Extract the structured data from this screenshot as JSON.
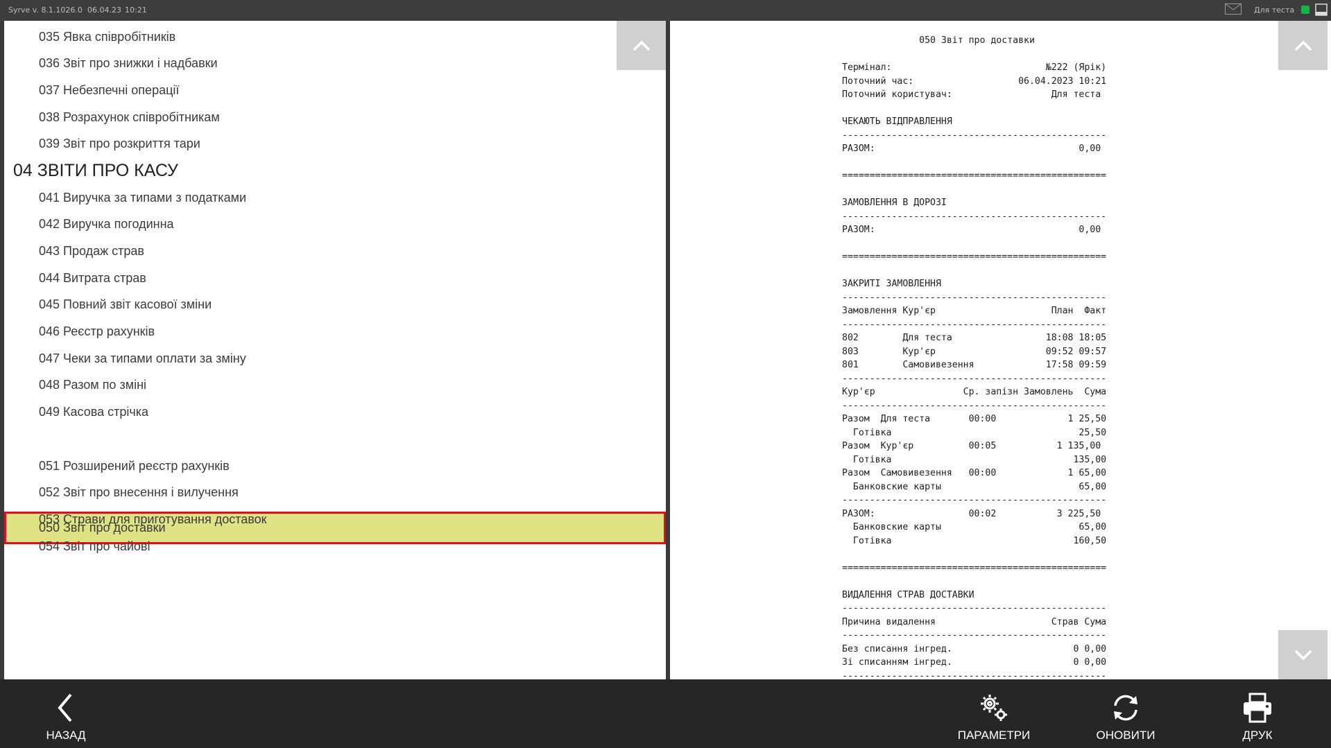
{
  "topbar": {
    "version": "Syrve v. 8.1.1026.0",
    "date": "06.04.23",
    "time": "10:21",
    "user": "Для теста",
    "status_color": "#17b34a"
  },
  "report_list": {
    "items": [
      {
        "label": "035 Явка співробітників",
        "type": "report"
      },
      {
        "label": "036 Звіт про знижки і надбавки",
        "type": "report"
      },
      {
        "label": "037 Небезпечні операції",
        "type": "report"
      },
      {
        "label": "038 Розрахунок співробітникам",
        "type": "report"
      },
      {
        "label": "039 Звіт про розкриття тари",
        "type": "report"
      },
      {
        "label": "04 ЗВІТИ ПРО КАСУ",
        "type": "section"
      },
      {
        "label": "041 Виручка за типами з податками",
        "type": "report"
      },
      {
        "label": "042 Виручка погодинна",
        "type": "report"
      },
      {
        "label": "043 Продаж страв",
        "type": "report"
      },
      {
        "label": "044 Витрата страв",
        "type": "report"
      },
      {
        "label": "045 Повний звіт касової зміни",
        "type": "report"
      },
      {
        "label": "046 Реєстр рахунків",
        "type": "report"
      },
      {
        "label": "047 Чеки за типами оплати за зміну",
        "type": "report"
      },
      {
        "label": "048 Разом по зміні",
        "type": "report"
      },
      {
        "label": "049 Касова стрічка",
        "type": "report"
      },
      {
        "label": "050 Звіт про доставки",
        "type": "report",
        "selected": true
      },
      {
        "label": "051 Розширений реєстр рахунків",
        "type": "report"
      },
      {
        "label": "052 Звіт про внесення і вилучення",
        "type": "report"
      },
      {
        "label": "053 Страви для приготування доставок",
        "type": "report"
      },
      {
        "label": "054 Звіт про чайові",
        "type": "report"
      }
    ],
    "selected_color": "#dfe384",
    "selected_border_color": "#e00f1e"
  },
  "report_preview": {
    "lines": [
      "              050 Звіт про доставки",
      "",
      "Термінал:                            №222 (Ярік)",
      "Поточний час:                   06.04.2023 10:21",
      "Поточний користувач:                  Для теста",
      "",
      "ЧЕКАЮТЬ ВІДПРАВЛЕННЯ",
      "------------------------------------------------",
      "РАЗОМ:                                     0,00",
      "",
      "================================================",
      "",
      "ЗАМОВЛЕННЯ В ДОРОЗІ",
      "------------------------------------------------",
      "РАЗОМ:                                     0,00",
      "",
      "================================================",
      "",
      "ЗАКРИТІ ЗАМОВЛЕННЯ",
      "------------------------------------------------",
      "Замовлення Кур'єр                     План  Факт",
      "------------------------------------------------",
      "802        Для теста                 18:08 18:05",
      "803        Кур'єр                    09:52 09:57",
      "801        Самовивезення             17:58 09:59",
      "------------------------------------------------",
      "Кур'єр                Ср. запізн Замовлень  Сума",
      "------------------------------------------------",
      "Разом  Для теста       00:00             1 25,50",
      "  Готівка                                  25,50",
      "Разом  Кур'єр          00:05           1 135,00",
      "  Готівка                                 135,00",
      "Разом  Самовивезення   00:00             1 65,00",
      "  Банковские карты                         65,00",
      "------------------------------------------------",
      "РАЗОМ:                 00:02           3 225,50",
      "  Банковские карты                         65,00",
      "  Готівка                                 160,50",
      "",
      "================================================",
      "",
      "ВИДАЛЕННЯ СТРАВ ДОСТАВКИ",
      "------------------------------------------------",
      "Причина видалення                     Страв Сума",
      "------------------------------------------------",
      "Без списання інгред.                      0 0,00",
      "Зі списанням інгред.                      0 0,00",
      "------------------------------------------------"
    ]
  },
  "bottombar": {
    "back_label": "НАЗАД",
    "params_label": "ПАРАМЕТРИ",
    "refresh_label": "ОНОВИТИ",
    "print_label": "ДРУК"
  },
  "icons": {
    "back": "chevron-left-icon",
    "params": "gears-icon",
    "refresh": "refresh-icon",
    "print": "printer-icon",
    "scroll_up": "chevron-up-icon",
    "scroll_down": "chevron-down-icon",
    "mail": "envelope-icon",
    "window": "window-icon"
  }
}
